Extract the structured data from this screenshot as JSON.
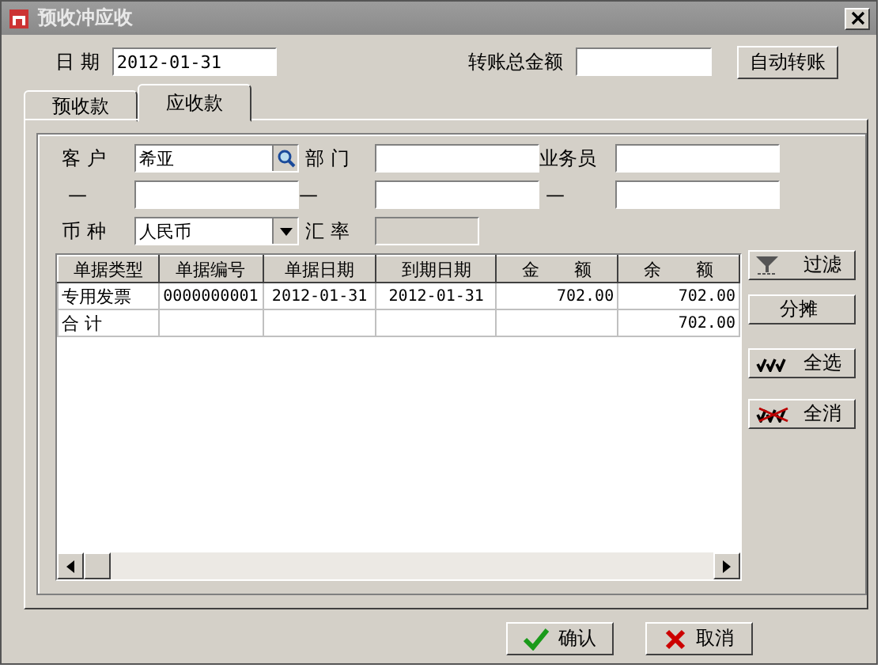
{
  "window": {
    "title": "预收冲应收"
  },
  "date": {
    "label": "日 期",
    "value": "2012-01-31"
  },
  "transfer_total": {
    "label": "转账总金额"
  },
  "auto_transfer_button": "自动转账",
  "tabs": [
    {
      "label": "预收款",
      "selected": false
    },
    {
      "label": "应收款",
      "selected": true
    }
  ],
  "filters": [
    {
      "label": "客 户",
      "value": "希亚",
      "kind": "lookup"
    },
    {
      "label": "部 门",
      "kind": "text"
    },
    {
      "label": "业务员",
      "kind": "text"
    },
    {
      "label": "—",
      "kind": "text"
    },
    {
      "label": "—",
      "kind": "text"
    },
    {
      "label": "—",
      "kind": "text"
    },
    {
      "label": "币 种",
      "value": "人民币",
      "kind": "select"
    },
    {
      "label": "汇 率",
      "kind": "disabled"
    }
  ],
  "table": {
    "columns": [
      "单据类型",
      "单据编号",
      "单据日期",
      "到期日期",
      "金　　额",
      "余　　额"
    ],
    "rows": [
      [
        "专用发票",
        "0000000001",
        "2012-01-31",
        "2012-01-31",
        "702.00",
        "702.00"
      ]
    ],
    "total": {
      "label": "合 计",
      "value": "702.00"
    }
  },
  "side_buttons": [
    {
      "label": "过滤",
      "kind": "filter"
    },
    {
      "label": "分摊",
      "kind": "plain"
    },
    {
      "label": "全选",
      "kind": "select-all"
    },
    {
      "label": "全消",
      "kind": "clear-all"
    }
  ],
  "buttons": [
    {
      "label": "确认",
      "kind": "ok"
    },
    {
      "label": "取消",
      "kind": "cancel"
    }
  ]
}
